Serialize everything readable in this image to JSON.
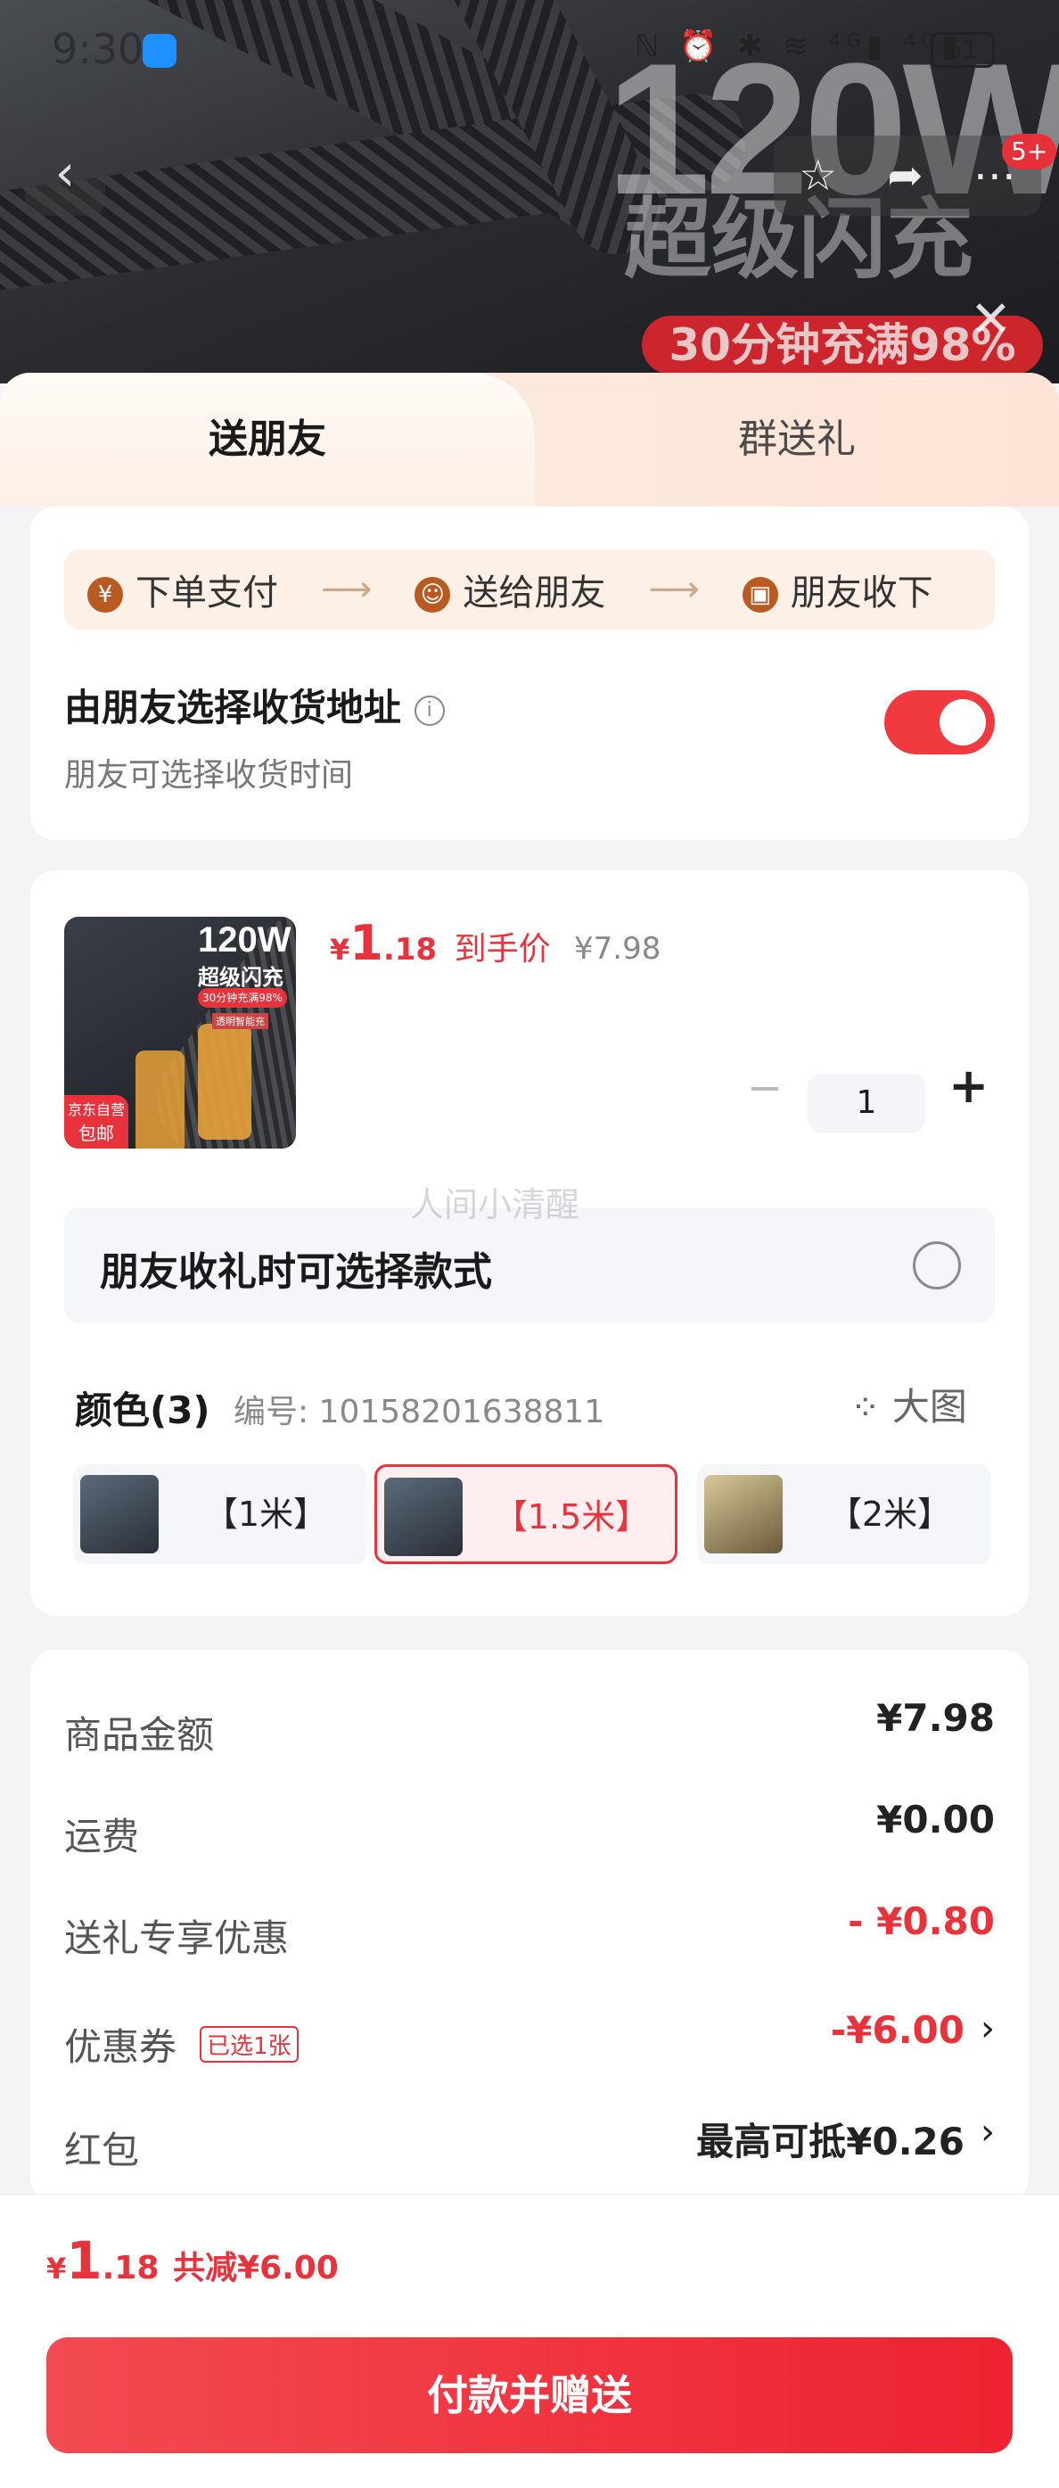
{
  "status_bar": {
    "time": "9:30",
    "battery": "51",
    "icons": "ℕ ⏰ ✱ ≋ ⁴ᴳ▮ ⁴ᴳ▮"
  },
  "banner": {
    "big_text": "120W",
    "subtitle": "超级闪充",
    "pill": "30分钟充满98%",
    "badge": "5+"
  },
  "tabs": {
    "active": "送朋友",
    "other": "群送礼"
  },
  "steps": [
    {
      "icon": "¥",
      "label": "下单支付"
    },
    {
      "icon": "☺",
      "label": "送给朋友"
    },
    {
      "icon": "▣",
      "label": "朋友收下"
    }
  ],
  "address": {
    "title": "由朋友选择收货地址",
    "subtitle": "朋友可选择收货时间",
    "toggle_on": true
  },
  "product": {
    "img_title": "120W",
    "img_subtitle": "超级闪充",
    "img_pill": "30分钟充满98%",
    "img_tag": "透明智能充",
    "img_badge": "京东自营",
    "img_badge2": "包邮",
    "price_symbol": "¥",
    "price_int": "1",
    "price_dec": ".18",
    "price_label": "到手价",
    "orig_price": "¥7.98",
    "qty": "1",
    "minus": "−",
    "plus": "+"
  },
  "option_select": {
    "label": "朋友收礼时可选择款式",
    "checked": false
  },
  "color": {
    "title": "颜色(3)",
    "code": "编号: 10158201638811",
    "big_image": "大图",
    "chips": [
      {
        "label": "【1米】",
        "selected": false
      },
      {
        "label": "【1.5米】",
        "selected": true
      },
      {
        "label": "【2米】",
        "selected": false
      }
    ]
  },
  "watermark": "人间小清醒",
  "summary": {
    "goods_label": "商品金额",
    "goods_value": "¥7.98",
    "shipping_label": "运费",
    "shipping_value": "¥0.00",
    "gift_label": "送礼专享优惠",
    "gift_value": "- ¥0.80",
    "coupon_label": "优惠券",
    "coupon_tag": "已选1张",
    "coupon_value": "-¥6.00",
    "redpacket_label": "红包",
    "redpacket_value": "最高可抵¥0.26"
  },
  "footer": {
    "price_symbol": "¥",
    "price_int": "1",
    "price_dec": ".18",
    "discount": "共减¥6.00",
    "pay_button": "付款并赠送"
  },
  "colors": {
    "accent": "#e8333c",
    "toggle": "#f03a40",
    "step_bg": "#fdf1e7"
  }
}
